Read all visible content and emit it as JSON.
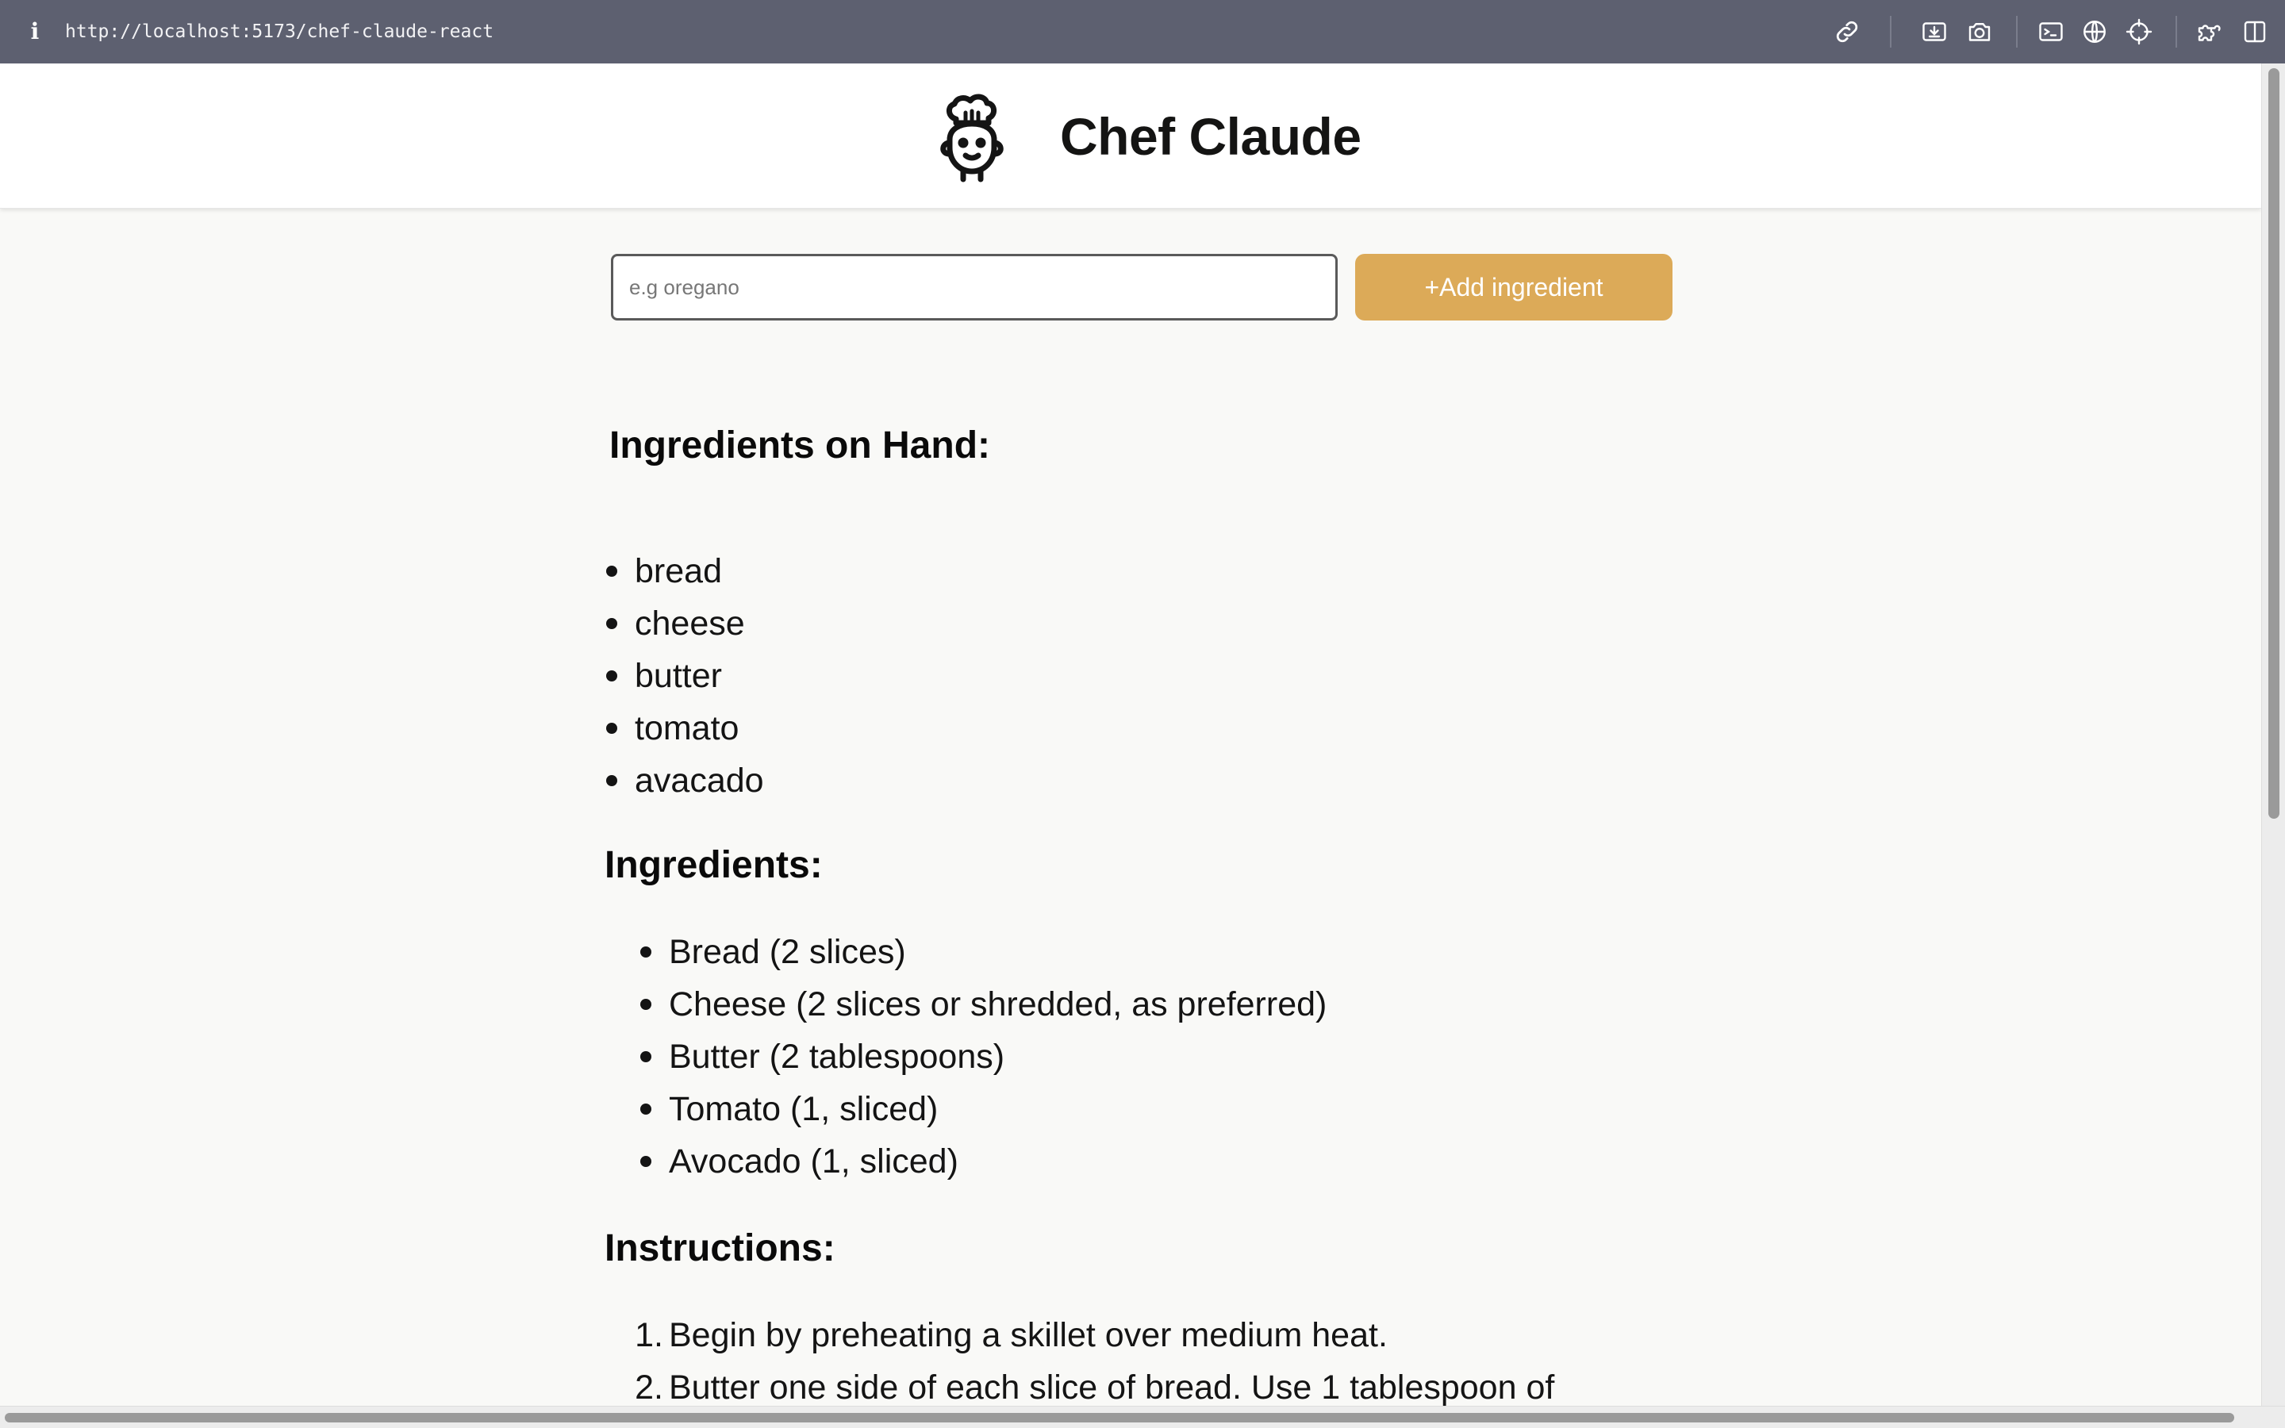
{
  "browser": {
    "info_label": "i",
    "url": "http://localhost:5173/chef-claude-react",
    "tools": [
      "link-icon",
      "download-icon",
      "camera-icon",
      "terminal-icon",
      "globe-icon",
      "crosshair-icon",
      "puzzle-icon",
      "sidebar-icon"
    ]
  },
  "header": {
    "title": "Chef Claude",
    "logo_icon": "chef-icon"
  },
  "form": {
    "input_placeholder": "e.g oregano",
    "input_value": "",
    "add_button_label": "+Add ingredient",
    "button_color": "#dcaa58"
  },
  "on_hand": {
    "heading": "Ingredients on Hand:",
    "items": [
      "bread",
      "cheese",
      "butter",
      "tomato",
      "avacado"
    ]
  },
  "recipe": {
    "ingredients_heading": "Ingredients:",
    "ingredients": [
      "Bread (2 slices)",
      "Cheese (2 slices or shredded, as preferred)",
      "Butter (2 tablespoons)",
      "Tomato (1, sliced)",
      "Avocado (1, sliced)"
    ],
    "instructions_heading": "Instructions:",
    "instructions": [
      {
        "number": "1.",
        "text": "Begin by preheating a skillet over medium heat."
      },
      {
        "number": "2.",
        "text": "Butter one side of each slice of bread. Use 1 tablespoon of"
      }
    ]
  }
}
